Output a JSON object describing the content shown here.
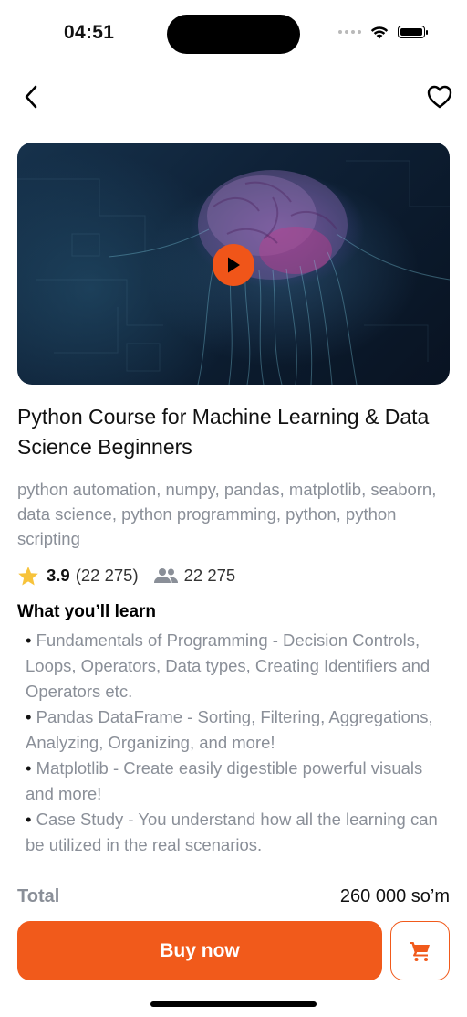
{
  "status_bar": {
    "time": "04:51"
  },
  "nav": {
    "back_icon": "chevron-left-icon",
    "favorite_icon": "heart-outline-icon"
  },
  "video": {
    "play_icon": "play-icon",
    "accent_color": "#f05519"
  },
  "course": {
    "title": "Python Course for Machine Learning & Data Science Beginners",
    "tags": "python automation, numpy, pandas, matplotlib, seaborn, data science, python programming, python, python scripting",
    "rating": "3.9",
    "rating_count": "(22 275)",
    "students": "22 275"
  },
  "learn": {
    "heading": "What you’ll learn",
    "bullet": "•",
    "items": [
      "Fundamentals of Programming - Decision Controls, Loops, Operators, Data types, Creating Identifiers and Operators etc.",
      "Pandas DataFrame - Sorting, Filtering, Aggregations, Analyzing, Organizing, and more!",
      "Matplotlib - Create easily digestible powerful visuals and more!",
      "Case Study - You understand how all the learning can be utilized in the real scenarios."
    ]
  },
  "footer": {
    "total_label": "Total",
    "total_price": "260 000 so’m",
    "buy_label": "Buy now",
    "cart_icon": "shopping-cart-icon",
    "brand_color": "#f15a1b"
  }
}
